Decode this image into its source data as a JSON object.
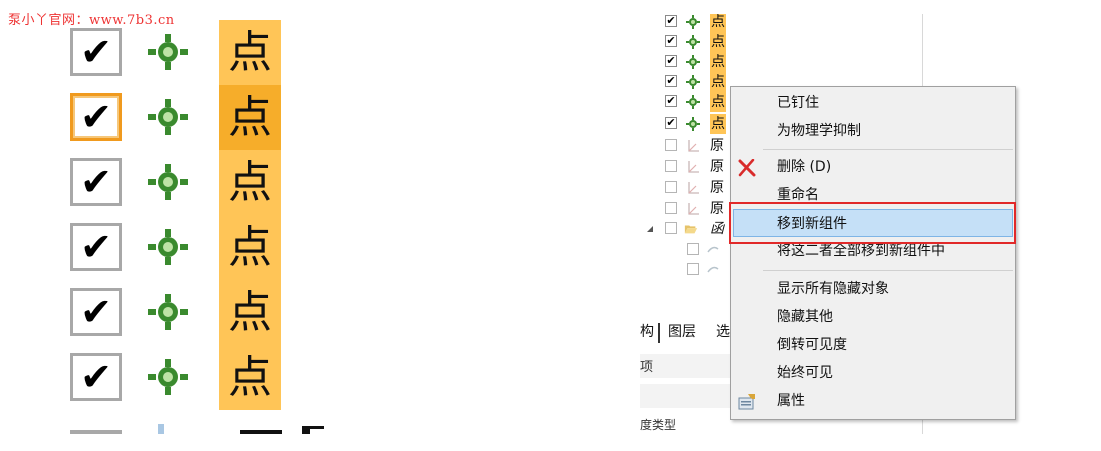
{
  "watermark": "泵小丫官网：www.7b3.cn",
  "zoom": {
    "rows": [
      {
        "check": "✔",
        "label": "点"
      },
      {
        "check": "✔",
        "label": "点"
      },
      {
        "check": "✔",
        "label": "点"
      },
      {
        "check": "✔",
        "label": "点"
      },
      {
        "check": "✔",
        "label": "点"
      },
      {
        "check": "✔",
        "label": "点"
      }
    ]
  },
  "tree": {
    "point_rows": [
      {
        "check": "✔",
        "label": "点"
      },
      {
        "check": "✔",
        "label": "点"
      },
      {
        "check": "✔",
        "label": "点"
      },
      {
        "check": "✔",
        "label": "点"
      },
      {
        "check": "✔",
        "label": "点"
      },
      {
        "check": "✔",
        "label": "点"
      }
    ],
    "origin_rows": [
      {
        "label": "原"
      },
      {
        "label": "原"
      },
      {
        "label": "原"
      },
      {
        "label": "原"
      }
    ],
    "group_row": {
      "label": "函"
    },
    "tabs": {
      "tab1": "构",
      "tab2": "图层",
      "tab3": "选"
    },
    "field1_label": "项",
    "bottom_text": "度类型"
  },
  "context_menu": {
    "items": {
      "pinned": "已钉住",
      "suppress_physics": "为物理学抑制",
      "delete": "删除 (D)",
      "rename": "重命名",
      "move_to_new_group": "移到新组件",
      "move_both_to_new_group": "将这二者全部移到新组件中",
      "show_all_hidden": "显示所有隐藏对象",
      "hide_others": "隐藏其他",
      "invert_visibility": "倒转可见度",
      "always_visible": "始终可见",
      "properties": "属性"
    }
  },
  "colors": {
    "highlight": "#ffc557",
    "menu_hover": "#c5e0f7",
    "callout_border": "#e12929",
    "point_icon": "#3a8a2e",
    "delete_icon": "#d92b2b"
  }
}
